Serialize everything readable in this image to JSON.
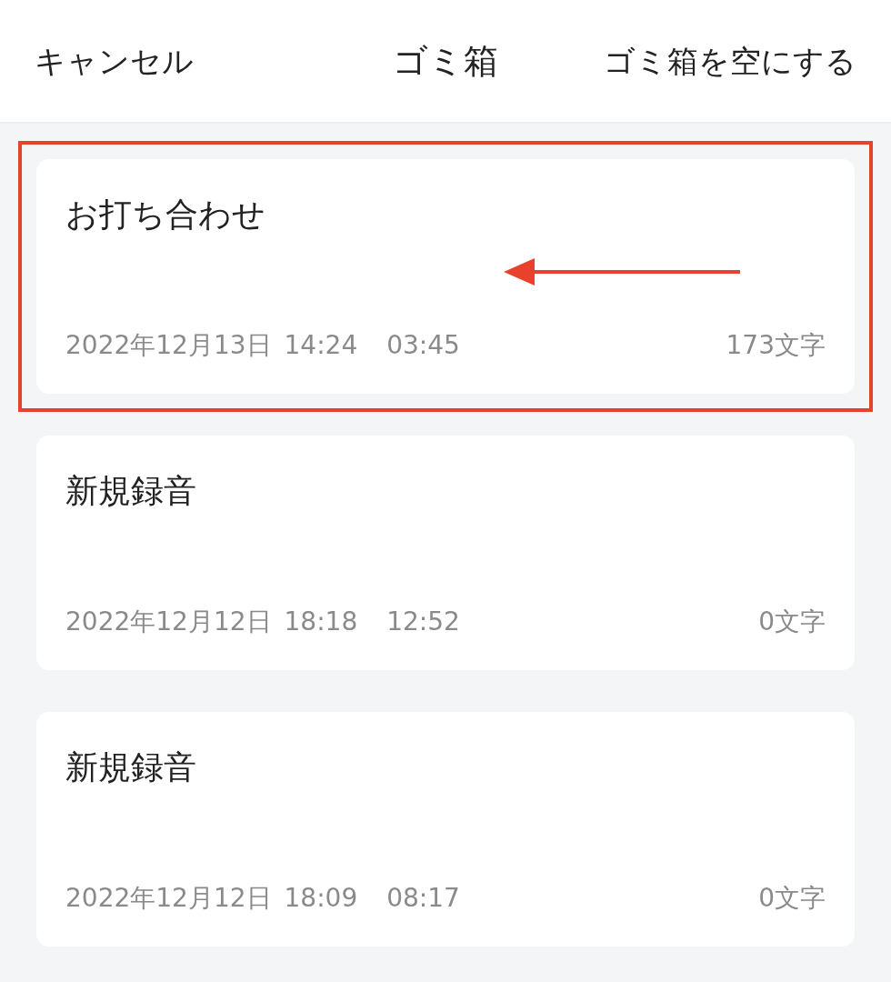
{
  "header": {
    "cancel": "キャンセル",
    "title": "ゴミ箱",
    "empty": "ゴミ箱を空にする"
  },
  "records": [
    {
      "title": "お打ち合わせ",
      "date": "2022年12月13日",
      "time": "14:24",
      "duration": "03:45",
      "chars": "173文字",
      "highlighted": true
    },
    {
      "title": "新規録音",
      "date": "2022年12月12日",
      "time": "18:18",
      "duration": "12:52",
      "chars": "0文字",
      "highlighted": false
    },
    {
      "title": "新規録音",
      "date": "2022年12月12日",
      "time": "18:09",
      "duration": "08:17",
      "chars": "0文字",
      "highlighted": false
    }
  ]
}
